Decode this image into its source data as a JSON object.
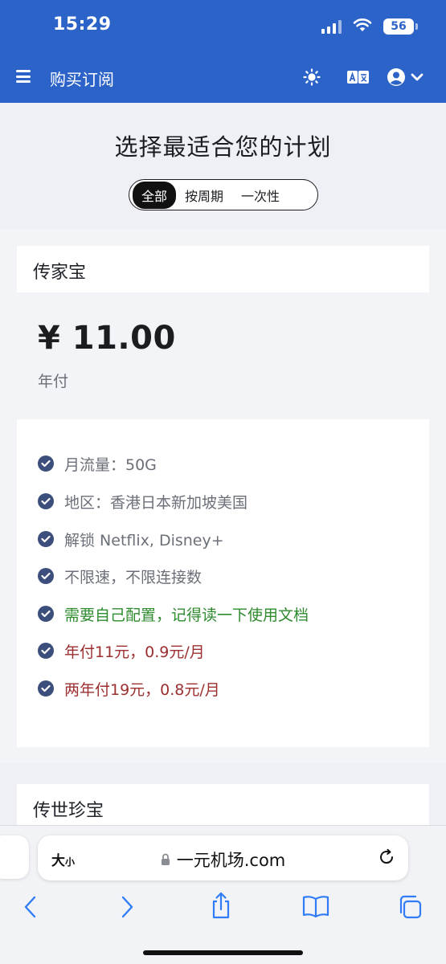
{
  "status_bar": {
    "time": "15:29",
    "battery": "56"
  },
  "nav": {
    "title": "购买订阅"
  },
  "hero": {
    "title": "选择最适合您的计划"
  },
  "filters": [
    {
      "label": "全部",
      "active": true
    },
    {
      "label": "按周期",
      "active": false
    },
    {
      "label": "一次性",
      "active": false
    }
  ],
  "plan": {
    "name": "传家宝",
    "price": "¥ 11.00",
    "period": "年付",
    "features": [
      {
        "text": "月流量：50G",
        "color": "#6b6f78"
      },
      {
        "text": "地区：香港日本新加坡美国",
        "color": "#6b6f78"
      },
      {
        "text": "解锁 Netflix, Disney+",
        "color": "#6b6f78"
      },
      {
        "text": "不限速，不限连接数",
        "color": "#6b6f78"
      },
      {
        "text": "需要自己配置，记得读一下使用文档",
        "color": "#2e8b2e"
      },
      {
        "text": "年付11元，0.9元/月",
        "color": "#9c2f2f"
      },
      {
        "text": "两年付19元，0.8元/月",
        "color": "#9c2f2f"
      }
    ]
  },
  "plan2": {
    "name": "传世珍宝"
  },
  "browser": {
    "text_size_label": "大",
    "text_size_small": "小",
    "url": "一元机场.com"
  },
  "colors": {
    "header": "#2b63c8",
    "check": "#3c4f7c",
    "toolbar_icons": "#2f7cf6"
  }
}
